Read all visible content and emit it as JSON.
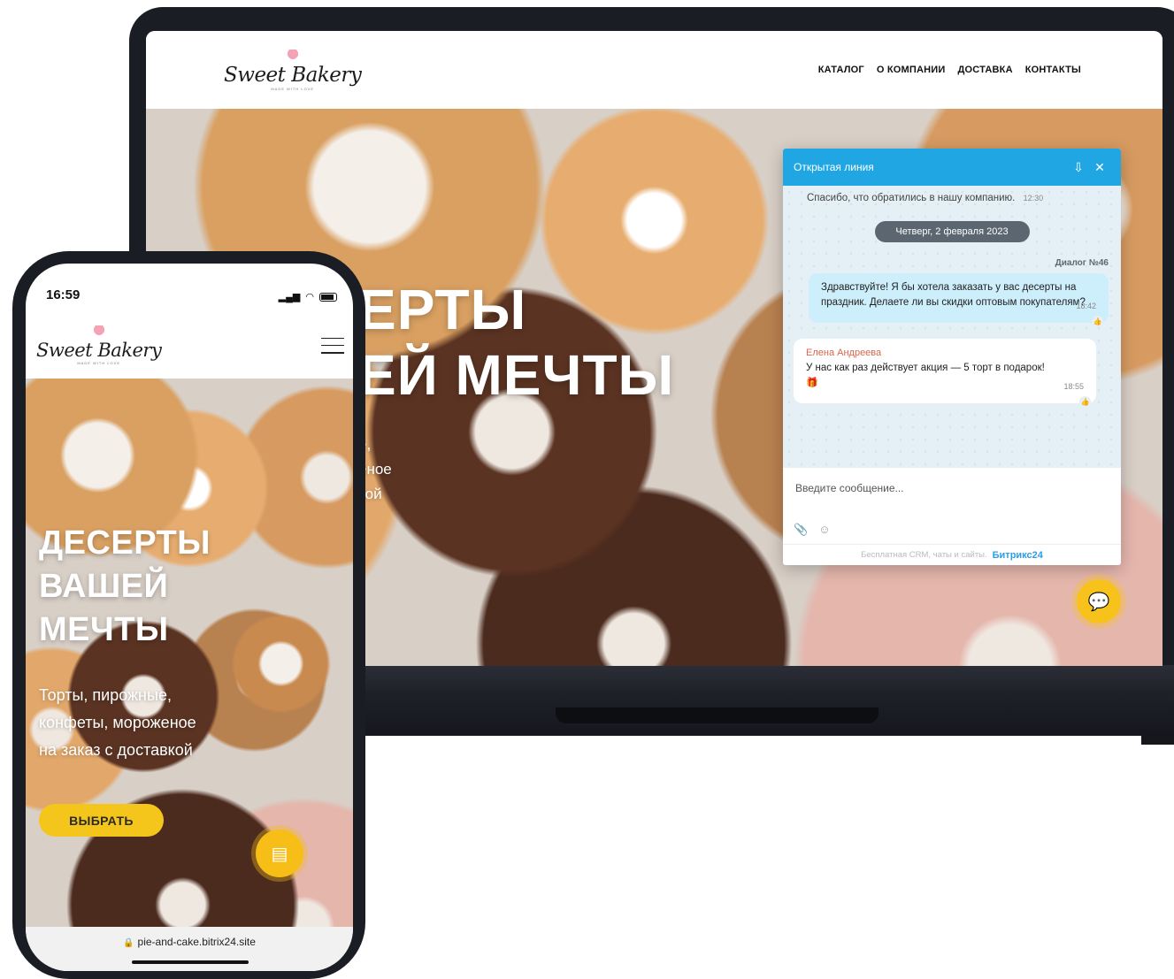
{
  "laptop": {
    "logo": {
      "text": "Sweet Bakery",
      "tagline": "MADE WITH LOVE"
    },
    "nav": [
      "КАТАЛОГ",
      "О КОМПАНИИ",
      "ДОСТАВКА",
      "КОНТАКТЫ"
    ],
    "hero": {
      "title_line1": "ЕРТЫ",
      "title_line2": "ЕЙ МЕЧТЫ",
      "sub_line1": "е,",
      "sub_line2": "еное",
      "sub_line3": "кой"
    }
  },
  "chat": {
    "title": "Открытая линия",
    "system_message": "Спасибо, что обратились в нашу компанию.",
    "system_time": "12:30",
    "date": "Четверг, 2 февраля 2023",
    "dialog_number": "Диалог №46",
    "client_message": "Здравствуйте! Я бы хотела заказать у вас десерты на праздник. Делаете ли вы скидки оптовым покупателям?",
    "client_time": "18:42",
    "operator_name": "Елена Андреева",
    "operator_message": "У нас как раз действует акция — 5 торт в подарок!",
    "operator_time": "18:55",
    "input_placeholder": "Введите сообщение...",
    "footer_text": "Бесплатная CRM, чаты и сайты.",
    "footer_brand": "Битрикс24"
  },
  "phone": {
    "status_time": "16:59",
    "logo": {
      "text": "Sweet Bakery",
      "tagline": "MADE WITH LOVE"
    },
    "hero": {
      "title_line1": "ДЕСЕРТЫ",
      "title_line2": "ВАШЕЙ",
      "title_line3": "МЕЧТЫ",
      "sub_line1": "Торты, пирожные,",
      "sub_line2": "конфеты, мороженое",
      "sub_line3": "на заказ с доставкой",
      "cta": "ВЫБРАТЬ"
    },
    "url": "pie-and-cake.bitrix24.site"
  },
  "colors": {
    "accent_yellow": "#f4c51a",
    "chat_header_blue": "#20a7e3",
    "client_bubble": "#cdeefb",
    "operator_name": "#d8664d"
  }
}
